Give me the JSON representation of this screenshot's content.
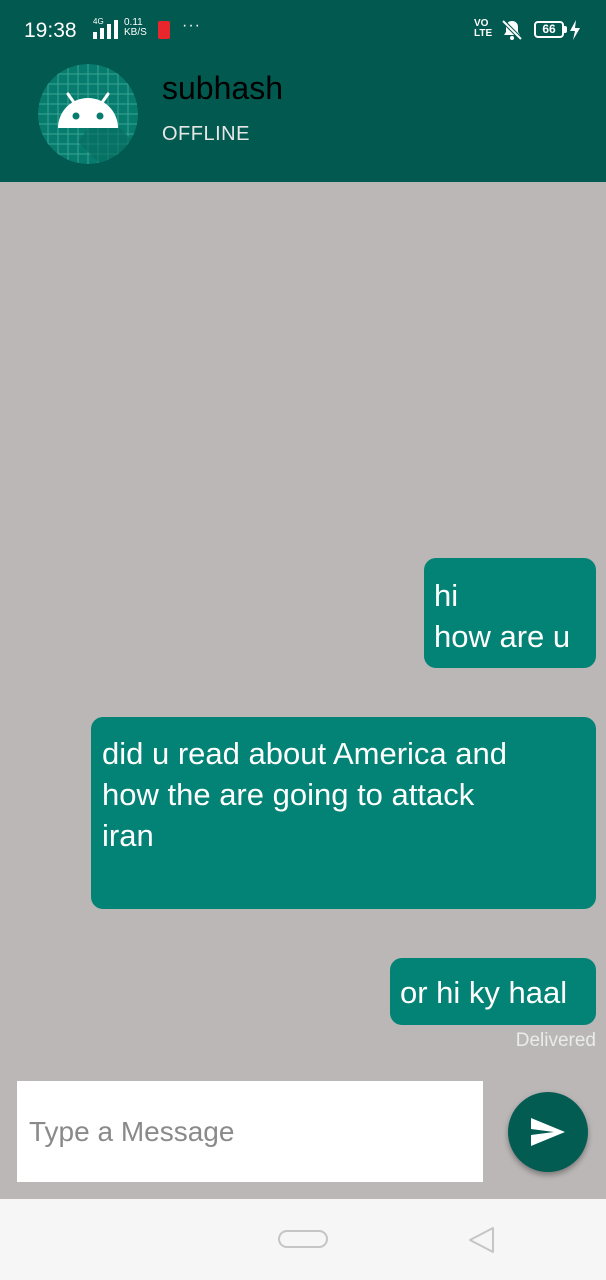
{
  "status_bar": {
    "time": "19:38",
    "network_tag": "4G",
    "speed_value": "0.11",
    "speed_unit": "KB/S",
    "more": "···",
    "volte_line1": "VO",
    "volte_line2": "LTE",
    "battery": "66",
    "icons": [
      "signal-icon",
      "app-notification-icon",
      "volte-icon",
      "mute-icon",
      "battery-icon",
      "charging-icon"
    ]
  },
  "header": {
    "contact_name": "subhash",
    "presence": "OFFLINE",
    "avatar_icon": "android-icon",
    "background_color": "#02594f"
  },
  "messages": [
    {
      "text_lines": [
        "hi",
        "how are u"
      ]
    },
    {
      "text_lines": [
        "did u read about America and",
        "how the are going to attack",
        "iran"
      ]
    },
    {
      "text_lines": [
        "or hi ky haal"
      ],
      "status": "Delivered"
    }
  ],
  "composer": {
    "placeholder": "Type a Message",
    "send_icon": "send-icon"
  },
  "colors": {
    "chat_background": "#bbb7b7",
    "bubble": "#028375",
    "send_button": "#035c52"
  },
  "nav_bar": {
    "icons": [
      "home-pill-icon",
      "back-triangle-icon"
    ]
  }
}
